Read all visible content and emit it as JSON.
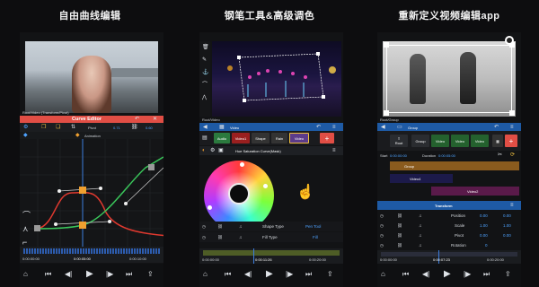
{
  "captions": [
    "自由曲线编辑",
    "钢笔工具&高级调色",
    "重新定义视频编辑app"
  ],
  "panel1": {
    "path_label": "Root/Video (Transform/Pivot)",
    "editor_title": "Curve Editor",
    "pivot_label": "Pivot",
    "pivot_x": "0.71",
    "pivot_y": "0.60",
    "animation_label": "Animation",
    "time_start": "0:00:00:00",
    "time_cursor": "0:00:05:00",
    "time_end": "0:00:10:00"
  },
  "panel2": {
    "path_label": "Root/Video",
    "header_label": "Video",
    "tabs": [
      "Audio",
      "Video1",
      "Shape",
      "Rain",
      "Video"
    ],
    "add_label": "+",
    "effect_title": "Hue Saturation Curve(Mask)",
    "rows": [
      {
        "label": "Shape Type",
        "value": "Pen Tool"
      },
      {
        "label": "Fill Type",
        "value": "Fill"
      }
    ],
    "time_start": "0:00:00:00",
    "time_cursor": "0:00:11:26",
    "time_end": "0:00:20:00"
  },
  "panel3": {
    "path_label": "Root/Group",
    "header_label": "Group",
    "chips": [
      "Root",
      "Group",
      "Video",
      "Video",
      "Video"
    ],
    "start_label": "Start",
    "start_value": "0:00:00:00",
    "duration_label": "Duration",
    "duration_value": "0:00:05:00",
    "layers": [
      "Group",
      "Video4",
      "Video2"
    ],
    "transform_title": "Transform",
    "props": [
      {
        "label": "Position",
        "v1": "0.00",
        "v2": "0.00"
      },
      {
        "label": "Scale",
        "v1": "1.00",
        "v2": "1.00"
      },
      {
        "label": "Pivot",
        "v1": "0.00",
        "v2": "0.00"
      },
      {
        "label": "Rotation",
        "v1": "0",
        "v2": ""
      }
    ],
    "time_start": "0:00:00:00",
    "time_cursor": "0:00:07:23",
    "time_end": "0:00:20:00"
  },
  "colors": {
    "accent_red": "#e14e45",
    "accent_blue": "#1e5aa5",
    "orange": "#f0a030",
    "green": "#33d66b"
  }
}
